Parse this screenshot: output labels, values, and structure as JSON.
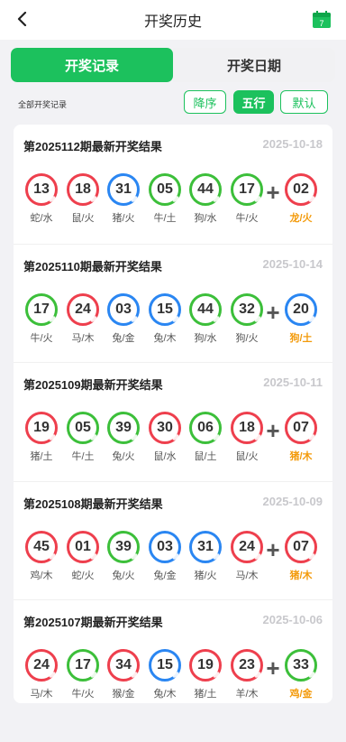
{
  "header": {
    "title": "开奖历史",
    "calendar_day": "7"
  },
  "tabs": [
    {
      "label": "开奖记录",
      "active": true
    },
    {
      "label": "开奖日期",
      "active": false
    }
  ],
  "filter": {
    "label": "全部开奖记录",
    "buttons": [
      {
        "label": "降序",
        "active": false
      },
      {
        "label": "五行",
        "active": true
      },
      {
        "label": "默认",
        "active": false
      }
    ]
  },
  "colors": {
    "accent": "#1cc15d",
    "red": "#ee3f4d",
    "green": "#3cbf3a",
    "blue": "#2a86f2",
    "special_text": "#f39a0a"
  },
  "draws": [
    {
      "title": "第2025112期最新开奖结果",
      "date": "2025-10-18",
      "balls": [
        {
          "num": "13",
          "color": "red",
          "zodiac": "蛇/水"
        },
        {
          "num": "18",
          "color": "red",
          "zodiac": "鼠/火"
        },
        {
          "num": "31",
          "color": "blue",
          "zodiac": "猪/火"
        },
        {
          "num": "05",
          "color": "green",
          "zodiac": "牛/土"
        },
        {
          "num": "44",
          "color": "green",
          "zodiac": "狗/水"
        },
        {
          "num": "17",
          "color": "green",
          "zodiac": "牛/火"
        },
        {
          "num": "02",
          "color": "red",
          "zodiac": "龙/火"
        }
      ]
    },
    {
      "title": "第2025110期最新开奖结果",
      "date": "2025-10-14",
      "balls": [
        {
          "num": "17",
          "color": "green",
          "zodiac": "牛/火"
        },
        {
          "num": "24",
          "color": "red",
          "zodiac": "马/木"
        },
        {
          "num": "03",
          "color": "blue",
          "zodiac": "兔/金"
        },
        {
          "num": "15",
          "color": "blue",
          "zodiac": "兔/木"
        },
        {
          "num": "44",
          "color": "green",
          "zodiac": "狗/水"
        },
        {
          "num": "32",
          "color": "green",
          "zodiac": "狗/火"
        },
        {
          "num": "20",
          "color": "blue",
          "zodiac": "狗/土"
        }
      ]
    },
    {
      "title": "第2025109期最新开奖结果",
      "date": "2025-10-11",
      "balls": [
        {
          "num": "19",
          "color": "red",
          "zodiac": "猪/土"
        },
        {
          "num": "05",
          "color": "green",
          "zodiac": "牛/土"
        },
        {
          "num": "39",
          "color": "green",
          "zodiac": "兔/火"
        },
        {
          "num": "30",
          "color": "red",
          "zodiac": "鼠/水"
        },
        {
          "num": "06",
          "color": "green",
          "zodiac": "鼠/土"
        },
        {
          "num": "18",
          "color": "red",
          "zodiac": "鼠/火"
        },
        {
          "num": "07",
          "color": "red",
          "zodiac": "猪/木"
        }
      ]
    },
    {
      "title": "第2025108期最新开奖结果",
      "date": "2025-10-09",
      "balls": [
        {
          "num": "45",
          "color": "red",
          "zodiac": "鸡/木"
        },
        {
          "num": "01",
          "color": "red",
          "zodiac": "蛇/火"
        },
        {
          "num": "39",
          "color": "green",
          "zodiac": "兔/火"
        },
        {
          "num": "03",
          "color": "blue",
          "zodiac": "兔/金"
        },
        {
          "num": "31",
          "color": "blue",
          "zodiac": "猪/火"
        },
        {
          "num": "24",
          "color": "red",
          "zodiac": "马/木"
        },
        {
          "num": "07",
          "color": "red",
          "zodiac": "猪/木"
        }
      ]
    },
    {
      "title": "第2025107期最新开奖结果",
      "date": "2025-10-06",
      "balls": [
        {
          "num": "24",
          "color": "red",
          "zodiac": "马/木"
        },
        {
          "num": "17",
          "color": "green",
          "zodiac": "牛/火"
        },
        {
          "num": "34",
          "color": "red",
          "zodiac": "猴/金"
        },
        {
          "num": "15",
          "color": "blue",
          "zodiac": "兔/木"
        },
        {
          "num": "19",
          "color": "red",
          "zodiac": "猪/土"
        },
        {
          "num": "23",
          "color": "red",
          "zodiac": "羊/木"
        },
        {
          "num": "33",
          "color": "green",
          "zodiac": "鸡/金"
        }
      ]
    }
  ]
}
